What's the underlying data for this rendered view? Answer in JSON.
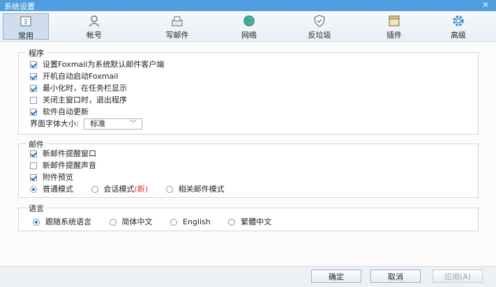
{
  "window": {
    "title": "系统设置",
    "close_glyph": "✕"
  },
  "tabs": [
    {
      "label": "常用",
      "icon": "general-icon",
      "selected": true
    },
    {
      "label": "帐号",
      "icon": "account-icon",
      "selected": false
    },
    {
      "label": "写邮件",
      "icon": "compose-icon",
      "selected": false
    },
    {
      "label": "网络",
      "icon": "network-icon",
      "selected": false
    },
    {
      "label": "反垃圾",
      "icon": "antispam-icon",
      "selected": false
    },
    {
      "label": "插件",
      "icon": "plugin-icon",
      "selected": false
    },
    {
      "label": "高级",
      "icon": "advanced-icon",
      "selected": false
    }
  ],
  "program": {
    "title": "程序",
    "options": [
      {
        "label": "设置Foxmail为系统默认邮件客户端",
        "checked": true
      },
      {
        "label": "开机自动启动Foxmail",
        "checked": true
      },
      {
        "label": "最小化时，在任务栏显示",
        "checked": true
      },
      {
        "label": "关闭主窗口时，退出程序",
        "checked": false
      },
      {
        "label": "软件自动更新",
        "checked": true
      }
    ],
    "font_size_label": "界面字体大小:",
    "font_size_value": "标准",
    "font_size_arrow": "﹀"
  },
  "mail": {
    "title": "邮件",
    "options": [
      {
        "label": "新邮件提醒窗口",
        "checked": true
      },
      {
        "label": "新邮件提醒声音",
        "checked": false
      },
      {
        "label": "附件预览",
        "checked": true
      }
    ],
    "modes": [
      {
        "label": "普通模式",
        "selected": true
      },
      {
        "label": "会话模式",
        "badge": "(新)",
        "selected": false
      },
      {
        "label": "相关邮件模式",
        "selected": false
      }
    ]
  },
  "language": {
    "title": "语言",
    "options": [
      {
        "label": "跟随系统语言",
        "selected": true
      },
      {
        "label": "简体中文",
        "selected": false
      },
      {
        "label": "English",
        "selected": false
      },
      {
        "label": "繁體中文",
        "selected": false
      }
    ]
  },
  "footer": {
    "ok": "确定",
    "cancel": "取消",
    "apply": "应用(A)"
  },
  "colors": {
    "titlebar": "#4f9fe0",
    "accent": "#2a6fb5",
    "new_badge": "#d43a2a"
  }
}
